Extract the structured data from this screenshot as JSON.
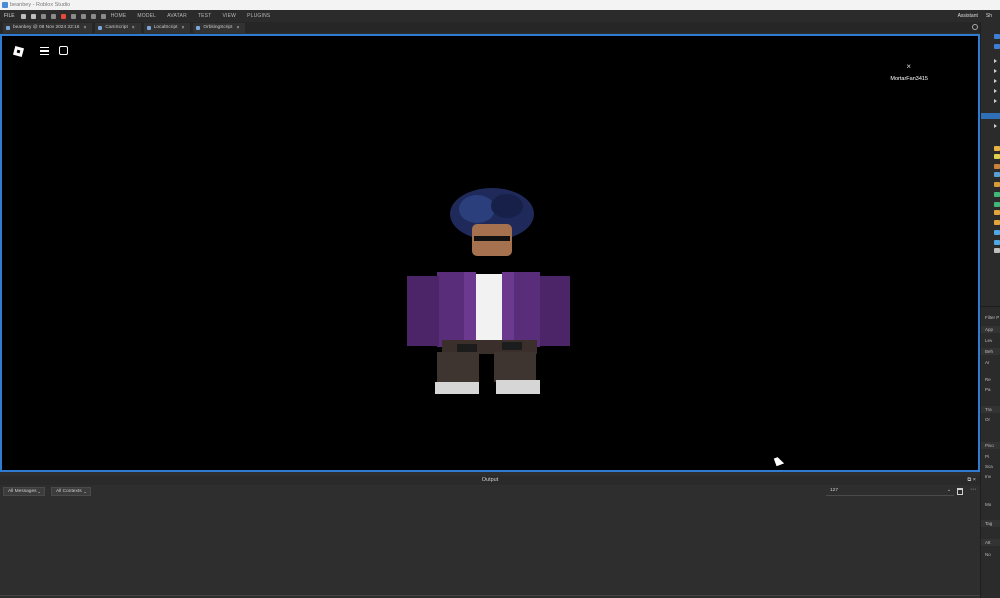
{
  "window": {
    "title": "beanbey - Roblox Studio"
  },
  "menubar": {
    "file": "FILE",
    "items": [
      "HOME",
      "MODEL",
      "AVATAR",
      "TEST",
      "VIEW",
      "PLUGINS"
    ],
    "assistant": "Assistant",
    "share": "Sh"
  },
  "tabs": [
    {
      "label": "beanbey @ 08 Nov 2024 22:16"
    },
    {
      "label": "CamScript"
    },
    {
      "label": "LocalScript"
    },
    {
      "label": "OrbitingScript"
    }
  ],
  "viewport": {
    "close_glyph": "×",
    "player_name": "MortarFan3415"
  },
  "output": {
    "title": "Output",
    "messages_filter": "All Messages",
    "contexts_filter": "All Contexts",
    "search_value": "127"
  },
  "right_panel": {
    "labels": [
      "Filter P",
      "App",
      "Lev",
      "Beh",
      "Ar",
      "Re",
      "Pa",
      "Tra",
      "Or",
      "Pivo",
      "Pi",
      "Sca",
      "Inv",
      "Mo",
      "Tag",
      "Att",
      "No"
    ]
  },
  "colors": {
    "accent": "#2f7bd1",
    "stop": "#e5483d",
    "selection": "#2f6fb8",
    "avatar_jacket": "#5a2d7a"
  }
}
